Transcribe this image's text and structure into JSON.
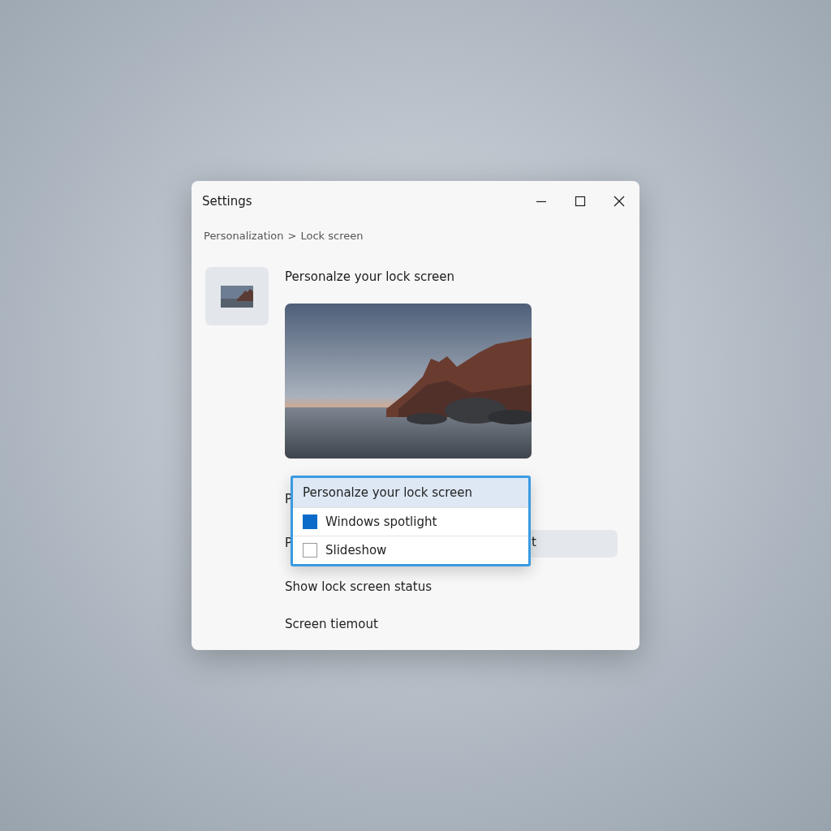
{
  "window": {
    "title": "Settings"
  },
  "breadcrumb": {
    "parent": "Personalization",
    "separator": ">",
    "current": "Lock screen"
  },
  "heading": "Personalze your lock screen",
  "rows": [
    {
      "label": "P"
    },
    {
      "label": "P",
      "control_text": "t"
    },
    {
      "label": "Show lock screen status"
    },
    {
      "label": "Screen tiemout"
    }
  ],
  "dropdown": {
    "header": {
      "label": "Personalze your lock screen",
      "selected": true
    },
    "options": [
      {
        "label": "Windows spotlight",
        "checked": true
      },
      {
        "label": "Slideshow",
        "checked": false
      }
    ]
  }
}
